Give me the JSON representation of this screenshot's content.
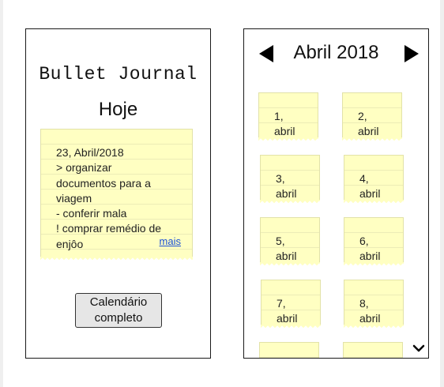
{
  "app": {
    "title": "Bullet Journal"
  },
  "today": {
    "heading": "Hoje",
    "note": {
      "lines": [
        "23, Abril/2018",
        "> organizar",
        "documentos para a",
        "viagem",
        "- conferir mala",
        "! comprar remédio de",
        "enjôo"
      ],
      "more_label": "mais"
    },
    "full_calendar_label_line1": "Calendário",
    "full_calendar_label_line2": "completo"
  },
  "calendar": {
    "month_title": "Abril 2018",
    "prev_icon": "triangle-left-icon",
    "next_icon": "triangle-right-icon",
    "scroll_icon": "chevron-down-icon",
    "days": [
      {
        "day": "1,",
        "month": "abril"
      },
      {
        "day": "2,",
        "month": "abril"
      },
      {
        "day": "3,",
        "month": "abril"
      },
      {
        "day": "4,",
        "month": "abril"
      },
      {
        "day": "5,",
        "month": "abril"
      },
      {
        "day": "6,",
        "month": "abril"
      },
      {
        "day": "7,",
        "month": "abril"
      },
      {
        "day": "8,",
        "month": "abril"
      }
    ]
  }
}
